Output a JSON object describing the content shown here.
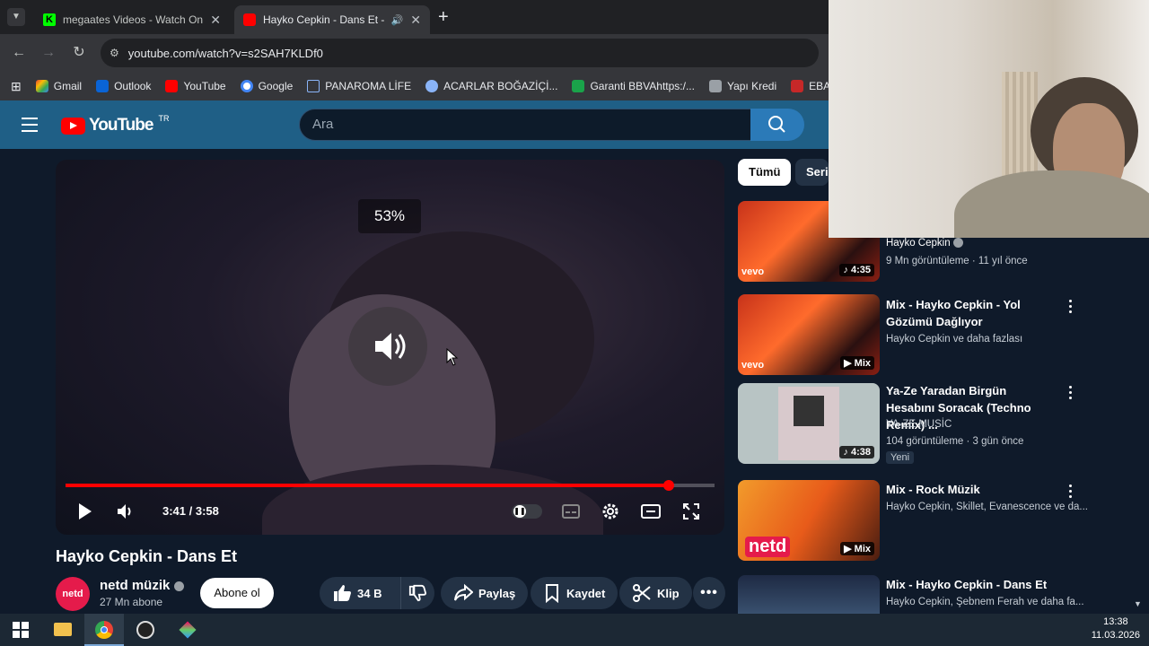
{
  "browser": {
    "tabs": [
      {
        "title": "megaates Videos - Watch On-D",
        "active": false
      },
      {
        "title": "Hayko Cepkin - Dans Et - Yo",
        "active": true
      }
    ],
    "new_tab": "+",
    "url": "youtube.com/watch?v=s2SAH7KLDf0",
    "bookmarks": [
      "Gmail",
      "Outlook",
      "YouTube",
      "Google",
      "PANAROMA LİFE",
      "ACARLAR BOĞAZİÇİ...",
      "Garanti BBVAhttps:/...",
      "Yapı Kredi",
      "EBA Hesabı"
    ]
  },
  "youtube": {
    "logo_text": "YouTube",
    "region": "TR",
    "search_placeholder": "Ara"
  },
  "player": {
    "volume_overlay": "53%",
    "time": "3:41 / 3:58",
    "progress": 0.93
  },
  "video": {
    "title": "Hayko Cepkin - Dans Et",
    "channel": "netd müzik",
    "channel_avatar_text": "netd",
    "subscribers": "27 Mn abone",
    "subscribe_label": "Abone ol",
    "likes": "34 B",
    "share_label": "Paylaş",
    "save_label": "Kaydet",
    "clip_label": "Klip"
  },
  "chips": [
    "Tümü",
    "Seri"
  ],
  "related": [
    {
      "title": "",
      "channel": "Hayko Cepkin",
      "meta": "9 Mn görüntüleme · 11 yıl önce",
      "badge": "4:35",
      "brand": "vevo"
    },
    {
      "title": "Mix - Hayko Cepkin - Yol Gözümü Dağlıyor",
      "channel": "Hayko Cepkin ve daha fazlası",
      "meta": "",
      "badge": "Mix",
      "brand": "vevo"
    },
    {
      "title": "Ya-Ze Yaradan Birgün Hesabını Soracak (Techno Remix) ...",
      "channel": "YA-ZE MUSİC",
      "meta": "104 görüntüleme · 3 gün önce",
      "badge": "4:38",
      "tag": "Yeni"
    },
    {
      "title": "Mix - Rock Müzik",
      "channel": "Hayko Cepkin, Skillet, Evanescence ve da...",
      "meta": "",
      "badge": "Mix",
      "brand": "netd"
    },
    {
      "title": "Mix - Hayko Cepkin - Dans Et",
      "channel": "Hayko Cepkin, Şebnem Ferah ve daha fa...",
      "meta": "",
      "badge": ""
    }
  ],
  "taskbar": {
    "time": "13:38",
    "date": "11.03.2026"
  },
  "colors": {
    "accent_red": "#ff0000",
    "header_blue": "#1f5f86",
    "page_bg": "#0f1a2a"
  }
}
